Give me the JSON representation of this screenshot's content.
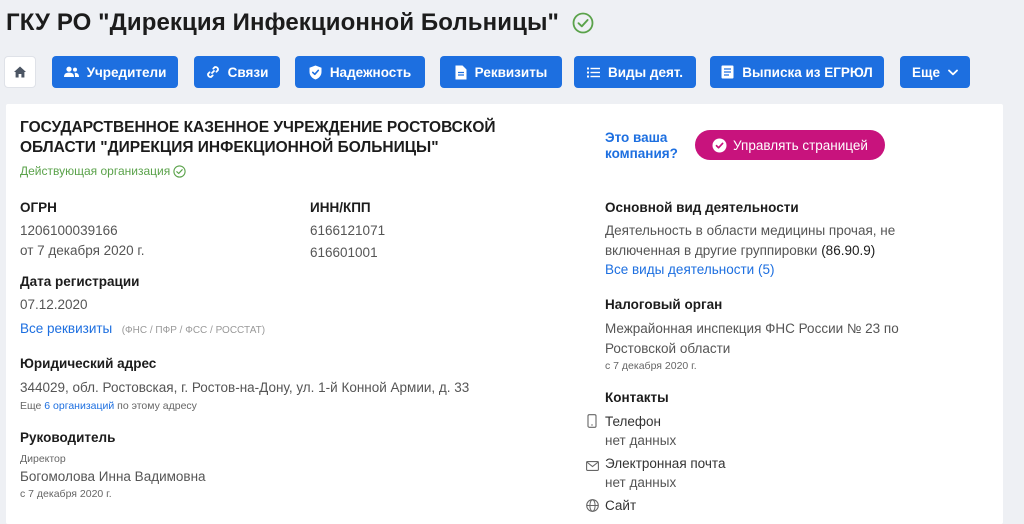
{
  "header": {
    "title": "ГКУ РО \"Дирекция Инфекционной Больницы\""
  },
  "nav": {
    "home_icon": "home-icon",
    "buttons": [
      {
        "label": "Учредители",
        "icon": "users-icon"
      },
      {
        "label": "Связи",
        "icon": "link-icon"
      },
      {
        "label": "Надежность",
        "icon": "shield-icon"
      },
      {
        "label": "Реквизиты",
        "icon": "document-icon"
      },
      {
        "label": "Виды деят.",
        "icon": "list-icon"
      },
      {
        "label": "Выписка из ЕГРЮЛ",
        "icon": "extract-icon"
      },
      {
        "label": "Еще",
        "icon": "chevron-down-icon"
      }
    ]
  },
  "company": {
    "full_name_line1": "ГОСУДАРСТВЕННОЕ КАЗЕННОЕ УЧРЕЖДЕНИЕ РОСТОВСКОЙ",
    "full_name_line2": "ОБЛАСТИ \"ДИРЕКЦИЯ ИНФЕКЦИОННОЙ БОЛЬНИЦЫ\"",
    "status": "Действующая организация"
  },
  "ogrn": {
    "label": "ОГРН",
    "value": "1206100039166",
    "date": "от 7 декабря 2020 г."
  },
  "inn_kpp": {
    "label": "ИНН/КПП",
    "inn": "6166121071",
    "kpp": "616601001"
  },
  "registration": {
    "label": "Дата регистрации",
    "value": "07.12.2020",
    "all_link": "Все реквизиты",
    "funds": "(ФНС / ПФР / ФСС / РОССТАТ)"
  },
  "address": {
    "label": "Юридический адрес",
    "value": "344029, обл. Ростовская, г. Ростов-на-Дону, ул. 1-й Конной Армии, д. 33",
    "more_prefix": "Еще",
    "more_link": "6 организаций",
    "more_suffix": "по этому адресу"
  },
  "head": {
    "label": "Руководитель",
    "position": "Директор",
    "name": "Богомолова Инна Вадимовна",
    "date": "с 7 декабря 2020 г."
  },
  "manage": {
    "question_line1": "Это ваша",
    "question_line2": "компания?",
    "button": "Управлять страницей"
  },
  "activity": {
    "label": "Основной вид деятельности",
    "line1": "Деятельность в области медицины прочая, не",
    "line2": "включенная в другие группировки",
    "code": "(86.90.9)",
    "all_link": "Все виды деятельности (5)"
  },
  "tax": {
    "label": "Налоговый орган",
    "line1": "Межрайонная инспекция ФНС России № 23 по",
    "line2": "Ростовской области",
    "date": "с 7 декабря 2020 г."
  },
  "contacts": {
    "label": "Контакты",
    "phone_label": "Телефон",
    "phone_value": "нет данных",
    "email_label": "Электронная почта",
    "email_value": "нет данных",
    "site_label": "Сайт"
  },
  "colors": {
    "accent": "#1d6fe0",
    "manage": "#c8137d",
    "active": "#5aa24a"
  }
}
